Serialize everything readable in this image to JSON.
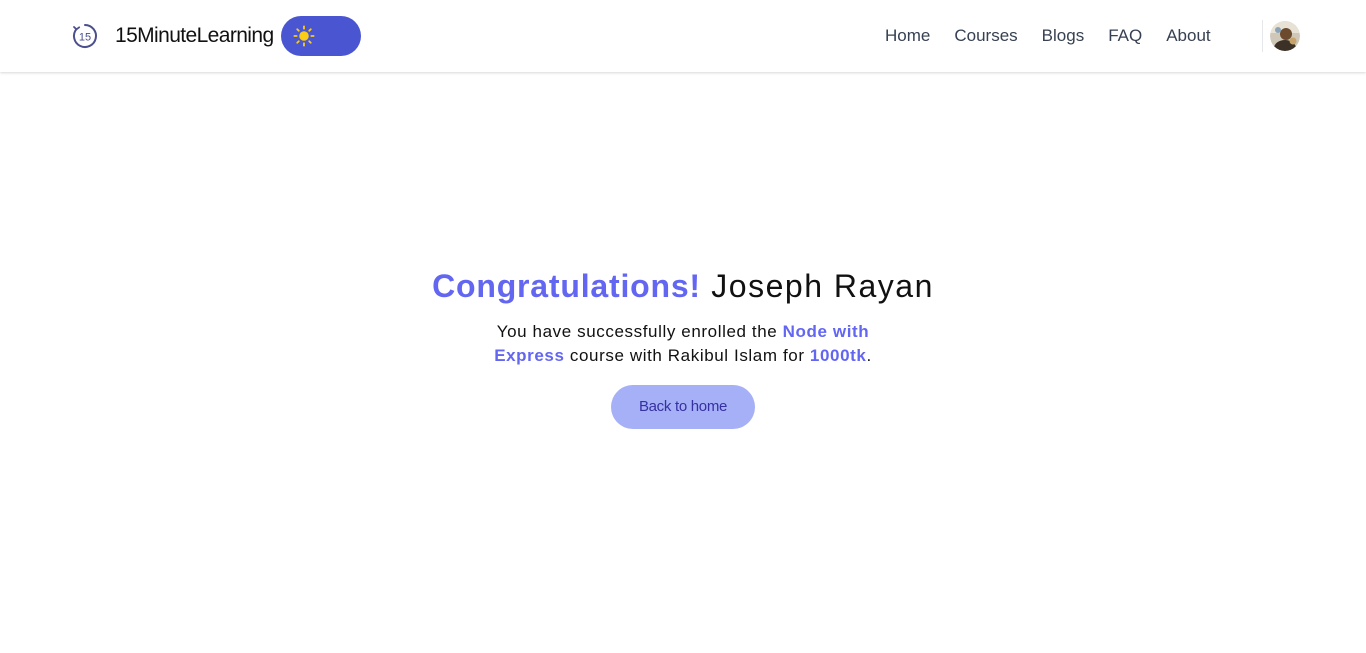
{
  "header": {
    "brand_name": "15MinuteLearning",
    "logo_text": "15",
    "logo_icon": "timer-15-icon",
    "theme_toggle_icon": "sun-icon",
    "nav": [
      {
        "label": "Home"
      },
      {
        "label": "Courses"
      },
      {
        "label": "Blogs"
      },
      {
        "label": "FAQ"
      },
      {
        "label": "About"
      }
    ],
    "avatar_icon": "user-avatar"
  },
  "main": {
    "congrats": "Congratulations!",
    "user_name": "Joseph Rayan",
    "message_part1": "You have successfully enrolled the ",
    "course_name": "Node with Express",
    "message_part2": " course with ",
    "instructor": "Rakibul Islam",
    "message_part3": " for ",
    "price": "1000tk",
    "message_end": ".",
    "back_button": "Back to home"
  },
  "colors": {
    "accent": "#6366f1",
    "toggle_bg": "#4a55d1",
    "sun": "#facc15",
    "button_bg": "#a5b0f6",
    "button_text": "#3730a3",
    "nav_text": "#374151"
  }
}
